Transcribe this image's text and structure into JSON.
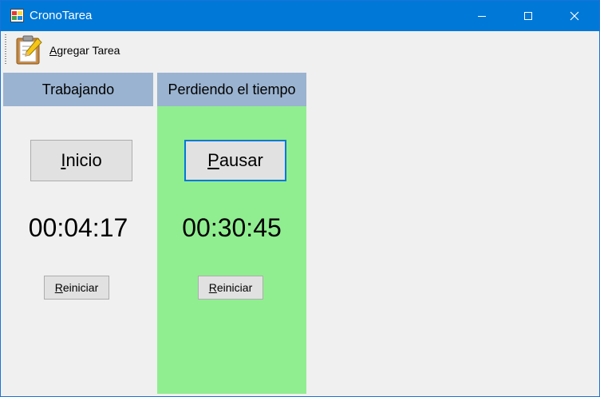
{
  "window": {
    "title": "CronoTarea"
  },
  "toolbar": {
    "add_task_mnemonic": "A",
    "add_task_rest": "gregar Tarea",
    "add_task_icon": "clipboard-pencil-icon"
  },
  "working": {
    "header": "Trabajando",
    "start_mnemonic": "I",
    "start_rest": "nicio",
    "time": "00:04:17",
    "reset_mnemonic": "R",
    "reset_rest": "einiciar"
  },
  "wasting": {
    "header": "Perdiendo el tiempo",
    "pause_mnemonic": "P",
    "pause_rest": "ausar",
    "time": "00:30:45",
    "reset_mnemonic": "R",
    "reset_rest": "einiciar",
    "active_color": "#90ee90"
  },
  "colors": {
    "titlebar": "#0078d7",
    "header_bg": "#9ab3d0",
    "focus_border": "#0078d7"
  }
}
